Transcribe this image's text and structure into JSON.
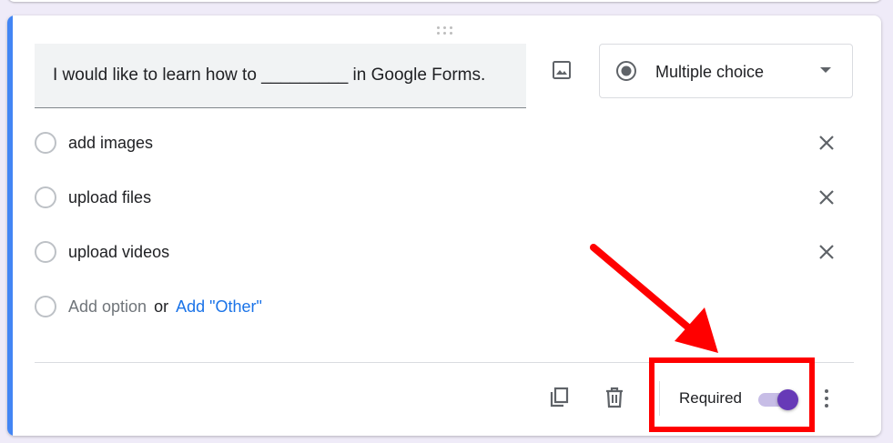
{
  "question": {
    "title": "I would like to learn how to _________ in Google Forms.",
    "type": "Multiple choice",
    "options": [
      {
        "label": "add images"
      },
      {
        "label": "upload files"
      },
      {
        "label": "upload videos"
      }
    ],
    "add_option_label": "Add option",
    "or_label": "or",
    "add_other_label": "Add \"Other\""
  },
  "footer": {
    "required_label": "Required",
    "required_on": true
  },
  "colors": {
    "accent": "#4285f4",
    "toggle_on": "#673ab7",
    "link": "#1a73e8",
    "annotation": "#ff0000"
  },
  "icons": [
    "drag-handle-icon",
    "image-icon",
    "radio-checked-icon",
    "dropdown-arrow-icon",
    "close-icon",
    "duplicate-icon",
    "delete-icon",
    "more-vert-icon"
  ]
}
